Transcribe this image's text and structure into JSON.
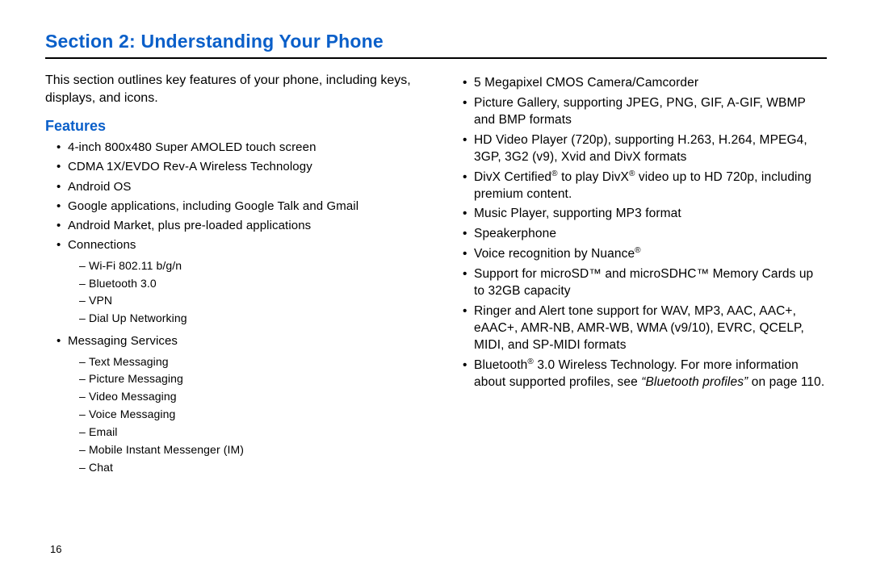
{
  "title": "Section 2: Understanding Your Phone",
  "intro": "This section outlines key features of your phone, including keys, displays, and icons.",
  "subheading": "Features",
  "page_number": "16",
  "left_items": [
    {
      "text": "4-inch 800x480 Super AMOLED touch screen"
    },
    {
      "text": "CDMA 1X/EVDO Rev-A Wireless Technology"
    },
    {
      "text": "Android OS"
    },
    {
      "text": "Google applications, including Google Talk and Gmail"
    },
    {
      "text": "Android Market, plus pre-loaded applications"
    },
    {
      "text": "Connections",
      "sub": [
        "Wi-Fi 802.11 b/g/n",
        "Bluetooth 3.0",
        "VPN",
        "Dial Up Networking"
      ]
    },
    {
      "text": "Messaging Services",
      "sub": [
        "Text Messaging",
        "Picture Messaging",
        "Video Messaging",
        "Voice Messaging",
        "Email",
        "Mobile Instant Messenger (IM)",
        "Chat"
      ]
    }
  ],
  "right_items": {
    "r0": "5 Megapixel CMOS Camera/Camcorder",
    "r1": "Picture Gallery, supporting JPEG, PNG, GIF, A-GIF, WBMP and BMP formats",
    "r2": "HD Video Player (720p), supporting H.263, H.264, MPEG4, 3GP, 3G2 (v9), Xvid and DivX formats",
    "r3_a": "DivX Certified",
    "r3_b": " to play DivX",
    "r3_c": " video up to HD 720p, including premium content.",
    "r4": "Music Player, supporting MP3 format",
    "r5": "Speakerphone",
    "r6_a": "Voice recognition by Nuance",
    "r7": "Support for microSD™ and microSDHC™ Memory Cards up to 32GB capacity",
    "r8": "Ringer and Alert tone support for WAV, MP3, AAC, AAC+, eAAC+, AMR-NB, AMR-WB, WMA (v9/10), EVRC, QCELP, MIDI, and SP-MIDI formats",
    "r9_a": "Bluetooth",
    "r9_b": " 3.0 Wireless Technology. For more information about supported profiles, see ",
    "r9_link": "“Bluetooth profiles”",
    "r9_c": " on page 110."
  },
  "reg_symbol": "®"
}
